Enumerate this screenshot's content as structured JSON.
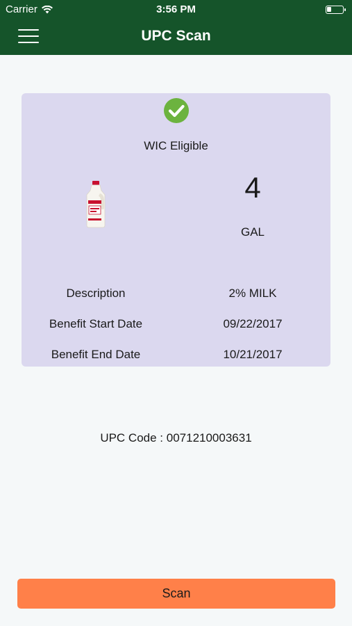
{
  "status_bar": {
    "carrier": "Carrier",
    "time": "3:56 PM",
    "wifi_icon": "wifi-icon",
    "battery_icon": "battery-icon"
  },
  "nav": {
    "title": "UPC Scan",
    "menu_icon": "hamburger-menu-icon"
  },
  "result": {
    "status_icon": "check-circle-icon",
    "status_text": "WIC Eligible",
    "product_image": "milk-jug-image",
    "quantity": "4",
    "unit": "GAL",
    "rows": [
      {
        "label": "Description",
        "value": "2% MILK"
      },
      {
        "label": "Benefit Start Date",
        "value": "09/22/2017"
      },
      {
        "label": "Benefit End Date",
        "value": "10/21/2017"
      }
    ]
  },
  "upc": {
    "label": "UPC Code :",
    "code": "0071210003631"
  },
  "actions": {
    "scan_label": "Scan"
  },
  "colors": {
    "header": "#15542a",
    "card": "#dbd8ef",
    "accent_button": "#ff8049",
    "check": "#6cb33f"
  }
}
